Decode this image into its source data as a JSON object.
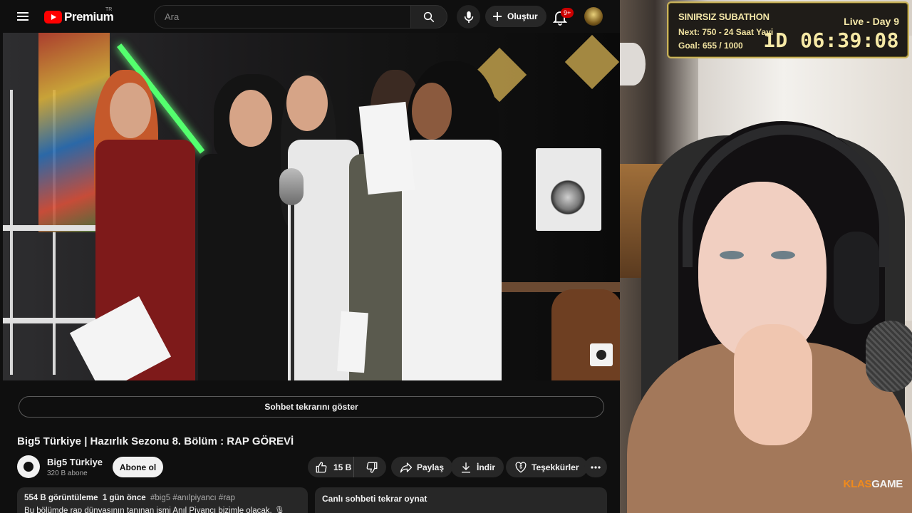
{
  "header": {
    "logo_text": "Premium",
    "logo_region": "TR",
    "search_placeholder": "Ara",
    "create_label": "Oluştur",
    "notification_badge": "9+"
  },
  "video": {
    "chat_replay_label": "Sohbet tekrarını göster",
    "title": "Big5 Türkiye | Hazırlık Sezonu 8. Bölüm : RAP GÖREVİ"
  },
  "channel": {
    "name": "Big5 Türkiye",
    "subscribers": "320 B abone",
    "subscribe_label": "Abone ol"
  },
  "actions": {
    "like_count": "15 B",
    "share_label": "Paylaş",
    "download_label": "İndir",
    "thanks_label": "Teşekkürler"
  },
  "description": {
    "views": "554 B görüntüleme",
    "age": "1 gün önce",
    "tags": "#big5 #anılpiyancı #rap",
    "text": "Bu bölümde rap dünyasının tanınan ismi Anıl Piyancı bizimle olacak. 🎙"
  },
  "live_chat": {
    "title": "Canlı sohbeti tekrar oynat"
  },
  "subathon": {
    "title": "SINIRSIZ SUBATHON",
    "next": "Next: 750 - 24 Saat Yayi",
    "goal": "Goal: 655 / 1000",
    "live_day": "Live - Day 9",
    "timer": "1D 06:39:08"
  },
  "webcam": {
    "watermark_brand": "KLAS",
    "watermark_suffix": "GAME"
  },
  "colors": {
    "youtube_red": "#ff0000",
    "background": "#0f0f0f",
    "pill": "#272727",
    "subathon_gold": "#c9b25a",
    "klasgame_orange": "#f08a1c"
  }
}
